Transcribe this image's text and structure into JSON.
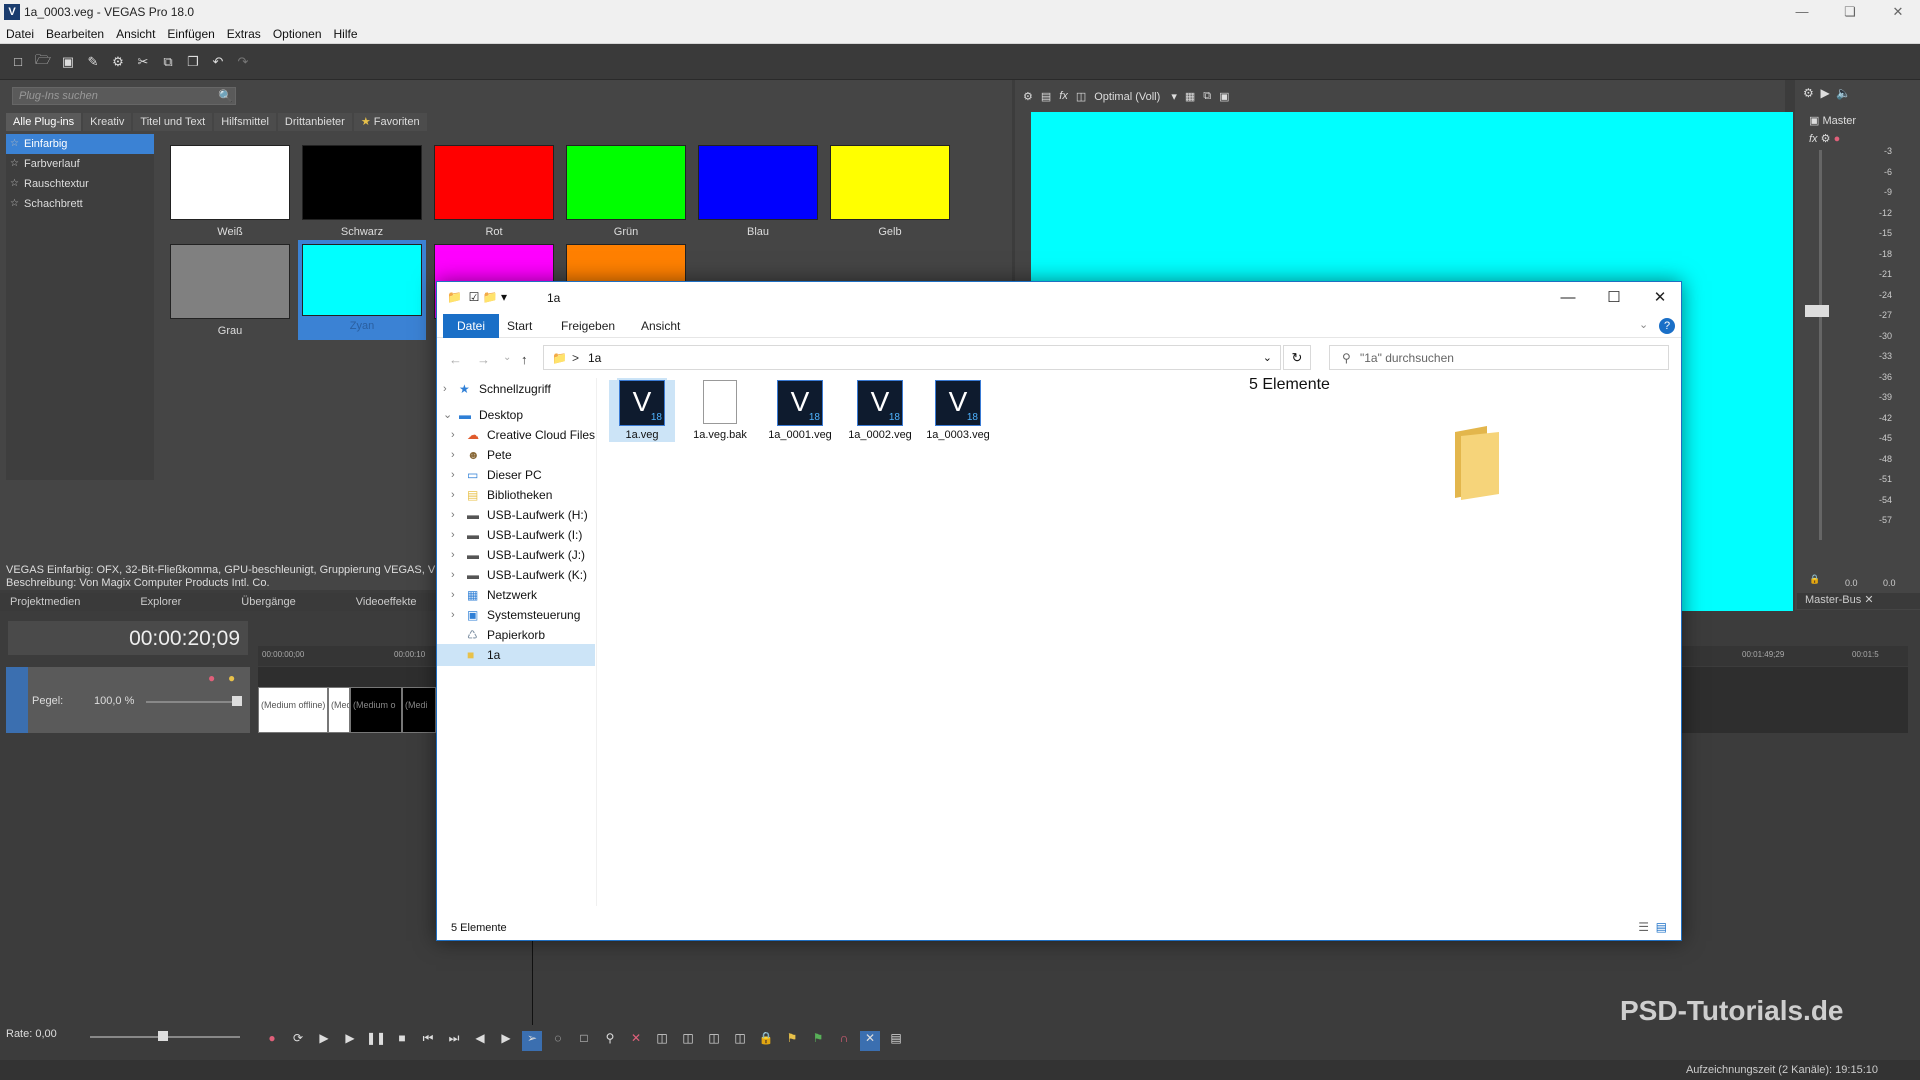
{
  "app": {
    "window_title": "1a_0003.veg - VEGAS Pro 18.0",
    "app_icon": "V",
    "menu": [
      "Datei",
      "Bearbeiten",
      "Ansicht",
      "Einfügen",
      "Extras",
      "Optionen",
      "Hilfe"
    ]
  },
  "plugins": {
    "search_placeholder": "Plug-Ins suchen",
    "tabs": [
      "Alle Plug-ins",
      "Kreativ",
      "Titel und Text",
      "Hilfsmittel",
      "Drittanbieter",
      "Favoriten"
    ],
    "list": [
      "Einfarbig",
      "Farbverlauf",
      "Rauschtextur",
      "Schachbrett"
    ],
    "selected_item": "Einfarbig",
    "swatches": [
      {
        "name": "Weiß",
        "color": "#ffffff"
      },
      {
        "name": "Schwarz",
        "color": "#000000"
      },
      {
        "name": "Rot",
        "color": "#ff0000"
      },
      {
        "name": "Grün",
        "color": "#00ff00"
      },
      {
        "name": "Blau",
        "color": "#0000ff"
      },
      {
        "name": "Gelb",
        "color": "#ffff00"
      },
      {
        "name": "Grau",
        "color": "#808080"
      },
      {
        "name": "Zyan",
        "color": "#00ffff"
      },
      {
        "name": "",
        "color": "#ff00ff"
      },
      {
        "name": "",
        "color": "#ff8000"
      }
    ],
    "description_line1": "VEGAS Einfarbig: OFX, 32-Bit-Fließkomma, GPU-beschleunigt, Gruppierung VEGAS, V",
    "description_line2": "Beschreibung: Von Magix Computer Products Intl. Co."
  },
  "preview": {
    "quality": "Optimal (Voll)",
    "preview_color": "#00ffff"
  },
  "master": {
    "label": "Master",
    "bus_label": "Master-Bus",
    "scale": [
      "-3",
      "-6",
      "-9",
      "-12",
      "-15",
      "-18",
      "-21",
      "-24",
      "-27",
      "-30",
      "-33",
      "-36",
      "-39",
      "-42",
      "-45",
      "-48",
      "-51",
      "-54",
      "-57"
    ],
    "bottom_values": [
      "0.0",
      "0.0"
    ]
  },
  "bottom_tabs": [
    "Projektmedien",
    "Explorer",
    "Übergänge",
    "Videoeffekte"
  ],
  "timeline": {
    "timecode": "00:00:20;09",
    "level_label": "Pegel:",
    "level_value": "100,0 %",
    "ruler_start": "00:00:00;00",
    "ruler_mid": "00:00:10",
    "ruler_end1": "00:01:49;29",
    "ruler_end2": "00:01:5",
    "clips": [
      "(Medium offline)",
      "(Med",
      "(Medium o",
      "(Medi"
    ],
    "rate": "Rate: 0,00"
  },
  "statusbar": {
    "text": "Aufzeichnungszeit (2 Kanäle): 19:15:10"
  },
  "watermark": "PSD-Tutorials.de",
  "explorer": {
    "title": "1a",
    "ribbon_tabs": [
      "Datei",
      "Start",
      "Freigeben",
      "Ansicht"
    ],
    "address_sep": ">",
    "address": "1a",
    "search_placeholder": "\"1a\" durchsuchen",
    "tree": [
      {
        "label": "Schnellzugriff",
        "icon": "star-icon"
      },
      {
        "label": "Desktop",
        "icon": "desktop-icon"
      },
      {
        "label": "Creative Cloud Files",
        "icon": "cloud-icon"
      },
      {
        "label": "Pete",
        "icon": "user-icon"
      },
      {
        "label": "Dieser PC",
        "icon": "pc-icon"
      },
      {
        "label": "Bibliotheken",
        "icon": "library-icon"
      },
      {
        "label": "USB-Laufwerk (H:)",
        "icon": "drive-icon"
      },
      {
        "label": "USB-Laufwerk (I:)",
        "icon": "drive-icon"
      },
      {
        "label": "USB-Laufwerk (J:)",
        "icon": "drive-icon"
      },
      {
        "label": "USB-Laufwerk (K:)",
        "icon": "drive-icon"
      },
      {
        "label": "Netzwerk",
        "icon": "network-icon"
      },
      {
        "label": "Systemsteuerung",
        "icon": "control-panel-icon"
      },
      {
        "label": "Papierkorb",
        "icon": "recycle-bin-icon"
      },
      {
        "label": "1a",
        "icon": "folder-icon"
      }
    ],
    "files": [
      {
        "name": "1a.veg",
        "icon": "vegas-project-icon"
      },
      {
        "name": "1a.veg.bak",
        "icon": "file-icon"
      },
      {
        "name": "1a_0001.veg",
        "icon": "vegas-project-icon"
      },
      {
        "name": "1a_0002.veg",
        "icon": "vegas-project-icon"
      },
      {
        "name": "1a_0003.veg",
        "icon": "vegas-project-icon"
      }
    ],
    "vegas_version": "18",
    "details_title": "5 Elemente",
    "status": "5 Elemente"
  }
}
